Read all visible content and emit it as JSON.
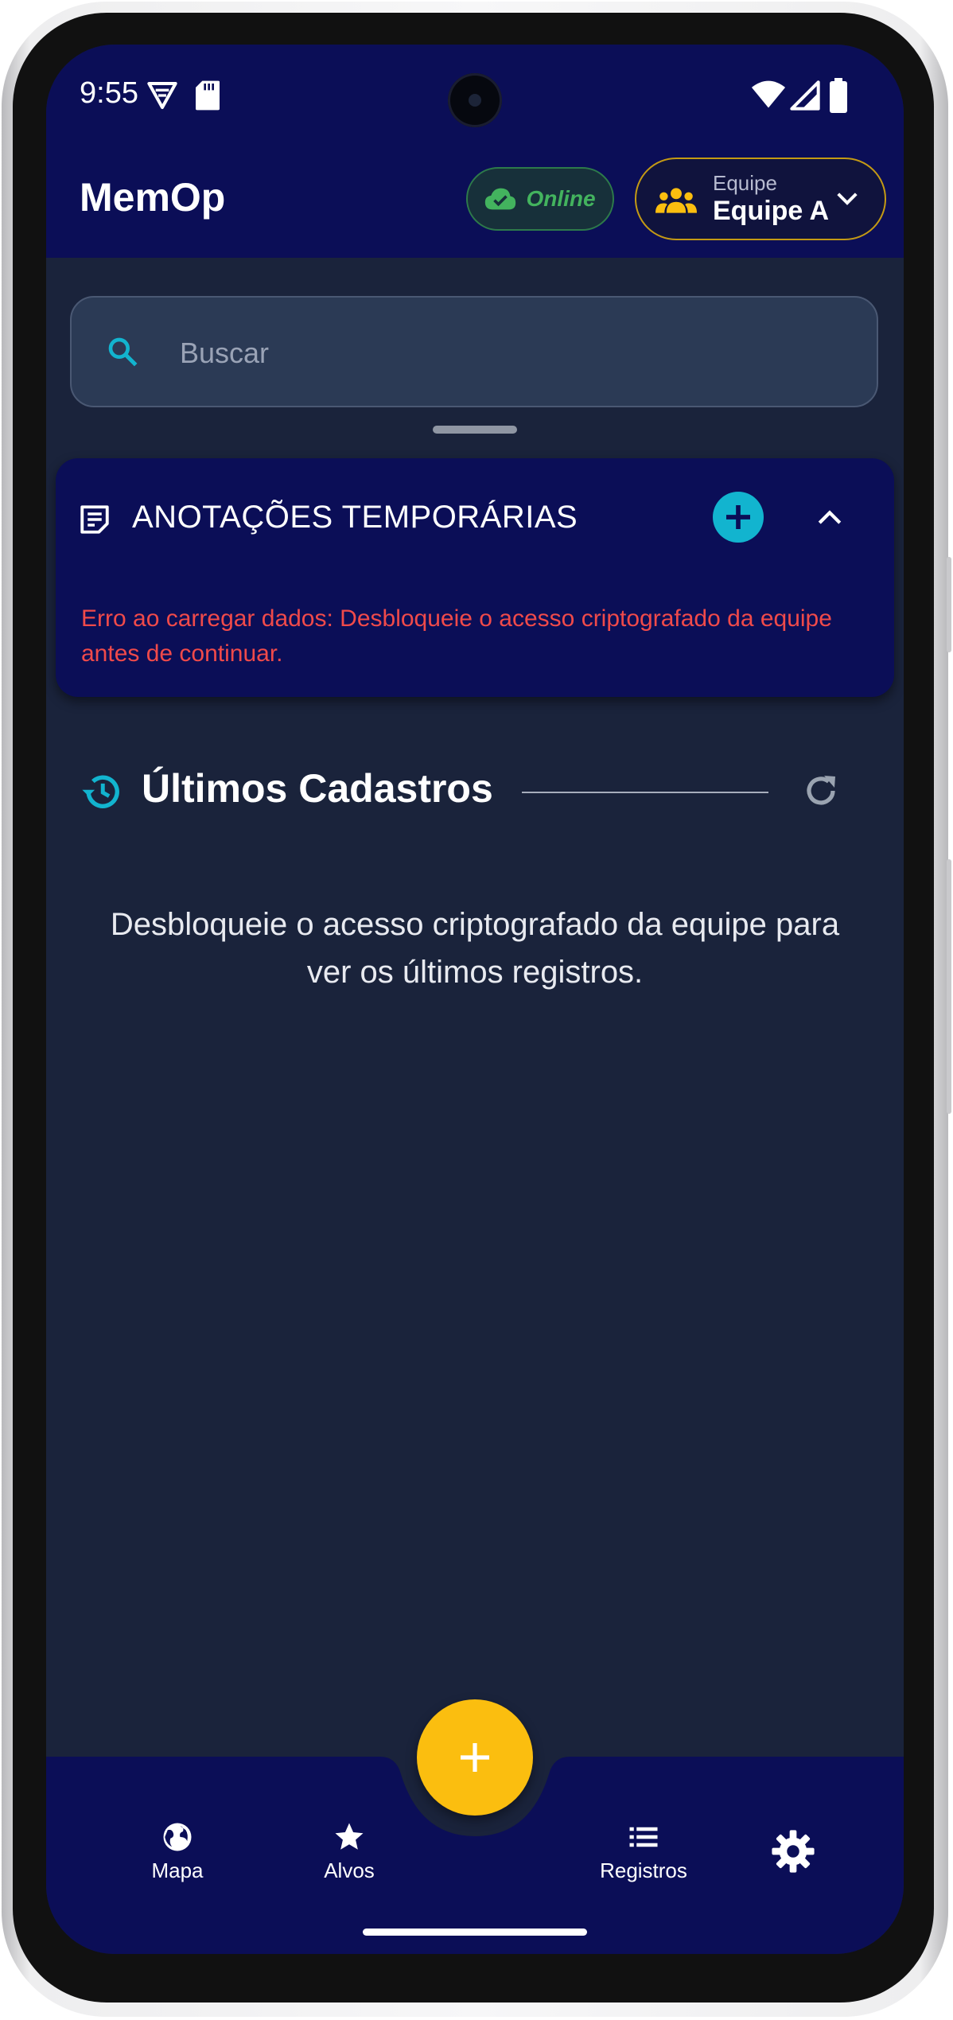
{
  "status_bar": {
    "time": "9:55"
  },
  "app_bar": {
    "title": "MemOp",
    "connection_label": "Online",
    "team_caption": "Equipe",
    "team_name": "Equipe A"
  },
  "search": {
    "placeholder": "Buscar"
  },
  "notes_section": {
    "title": "ANOTAÇÕES TEMPORÁRIAS",
    "error_text": "Erro ao carregar dados: Desbloqueie o acesso criptografado da equipe antes de continuar."
  },
  "recent_section": {
    "title": "Últimos Cadastros",
    "empty_message": "Desbloqueie o acesso criptografado da equipe para ver os últimos registros."
  },
  "bottom_nav": {
    "items": [
      {
        "label": "Mapa",
        "icon": "globe-icon"
      },
      {
        "label": "Alvos",
        "icon": "star-icon"
      },
      {
        "label": "Registros",
        "icon": "list-icon"
      },
      {
        "label": "",
        "icon": "gear-icon"
      }
    ],
    "fab_icon": "plus-icon"
  },
  "colors": {
    "app_bar_bg": "#0b0e57",
    "page_bg": "#1a233b",
    "accent_cyan": "#12b4cf",
    "accent_yellow": "#fbbe0f",
    "online_green": "#43b35e",
    "error_red": "#f04a4a"
  }
}
